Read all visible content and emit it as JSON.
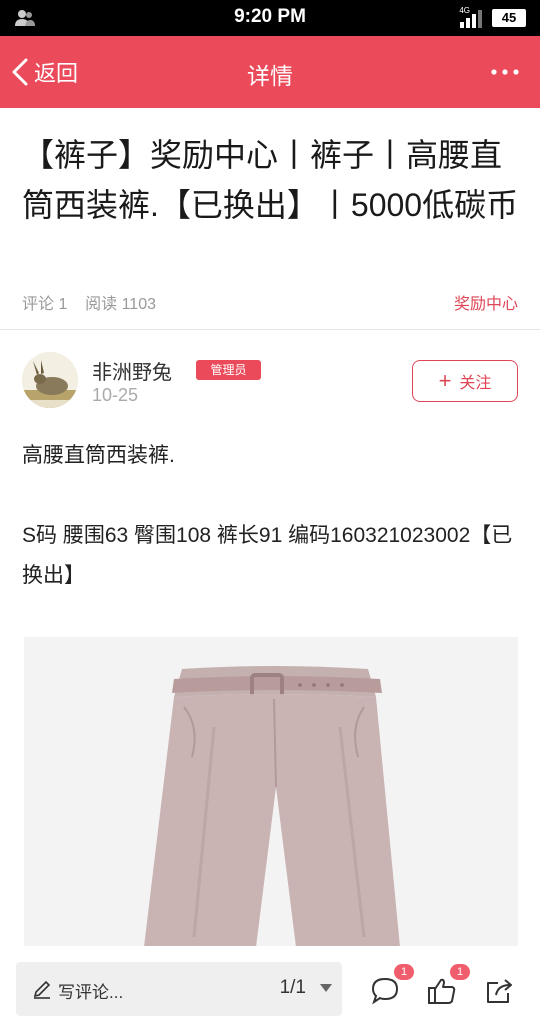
{
  "status_bar": {
    "time": "9:20 PM",
    "network": "4G",
    "battery": "45"
  },
  "nav": {
    "back_label": "返回",
    "title": "详情"
  },
  "post": {
    "title": "【裤子】奖励中心丨裤子丨高腰直筒西装裤.【已换出】丨5000低碳币",
    "comment_count_text": "评论 1",
    "read_count_text": "阅读 1103",
    "category_link": "奖励中心"
  },
  "author": {
    "name": "非洲野兔",
    "badge": "管理员",
    "date": "10-25",
    "follow_label": "关注"
  },
  "content": {
    "paragraph1": "高腰直筒西装裤.",
    "paragraph2": "S码  腰围63  臀围108  裤长91  编码160321023002【已换出】"
  },
  "bottom_bar": {
    "comment_placeholder": "写评论...",
    "page_indicator": "1/1",
    "comments_badge": "1",
    "likes_badge": "1"
  },
  "icons": {
    "back": "chevron-left-icon",
    "more": "more-horizontal-icon",
    "pen": "pen-icon",
    "comment": "speech-bubble-icon",
    "like": "thumbs-up-icon",
    "share": "share-icon"
  },
  "colors": {
    "accent": "#ea4a5a",
    "link": "#e04656",
    "meta_text": "#9a9a9a",
    "badge": "#f05d6c"
  }
}
